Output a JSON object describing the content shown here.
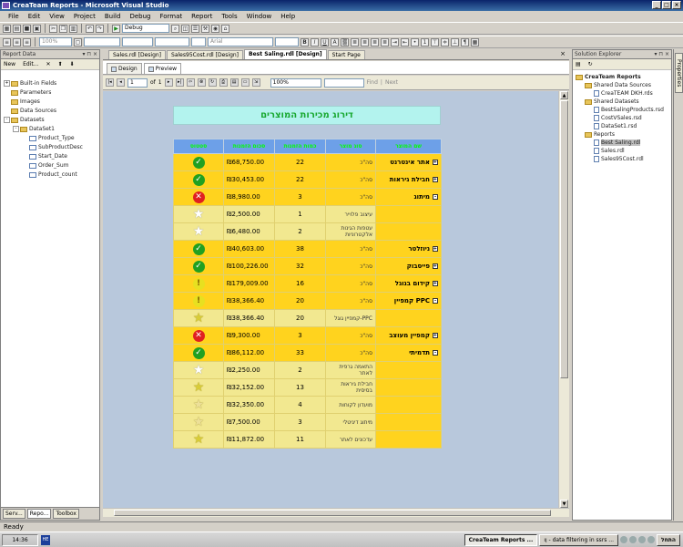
{
  "window": {
    "title": "CreaTeam Reports - Microsoft Visual Studio"
  },
  "menu": [
    "File",
    "Edit",
    "View",
    "Project",
    "Build",
    "Debug",
    "Format",
    "Report",
    "Tools",
    "Window",
    "Help"
  ],
  "toolbar": {
    "config": "Debug",
    "zoom": "100%",
    "font": "Arial"
  },
  "left_pane": {
    "title": "Report Data",
    "new_label": "New",
    "edit_label": "Edit...",
    "tree": [
      {
        "label": "Built-in Fields",
        "level": 0,
        "kind": "folder",
        "exp": "+"
      },
      {
        "label": "Parameters",
        "level": 0,
        "kind": "folder",
        "exp": ""
      },
      {
        "label": "Images",
        "level": 0,
        "kind": "folder",
        "exp": ""
      },
      {
        "label": "Data Sources",
        "level": 0,
        "kind": "folder",
        "exp": ""
      },
      {
        "label": "Datasets",
        "level": 0,
        "kind": "folder",
        "exp": "-"
      },
      {
        "label": "DataSet1",
        "level": 1,
        "kind": "folder",
        "exp": "-"
      },
      {
        "label": "Product_Type",
        "level": 2,
        "kind": "field",
        "exp": ""
      },
      {
        "label": "SubProductDesc",
        "level": 2,
        "kind": "field",
        "exp": ""
      },
      {
        "label": "Start_Date",
        "level": 2,
        "kind": "field",
        "exp": ""
      },
      {
        "label": "Order_Sum",
        "level": 2,
        "kind": "field",
        "exp": ""
      },
      {
        "label": "Product_count",
        "level": 2,
        "kind": "field",
        "exp": ""
      }
    ],
    "bottom_tabs": [
      "Serv...",
      "Repo...",
      "Toolbox"
    ]
  },
  "doc_tabs": [
    "Sales.rdl [Design]",
    "Sales95Cost.rdl [Design]",
    "Best Saling.rdl [Design]",
    "Start Page"
  ],
  "design_tabs": {
    "design": "Design",
    "preview": "Preview"
  },
  "report_toolbar": {
    "page": "1",
    "of_label": "of",
    "total": "1",
    "zoom": "100%",
    "find": "Find",
    "next": "Next"
  },
  "report": {
    "title": "דירוג מכירות המוצרים",
    "headers": [
      "שם המוצר",
      "סוג מוצר",
      "כמות הזמנות",
      "סכום הזמנות",
      "סטטוס"
    ],
    "rows": [
      {
        "product": "אתר אינטרנט",
        "toggle": "+",
        "ptype": "סה\"כ",
        "count": "22",
        "sum": "₪68,750.00",
        "status": "ok",
        "sub": false
      },
      {
        "product": "חבילת גיראות",
        "toggle": "+",
        "ptype": "סה\"כ",
        "count": "22",
        "sum": "₪30,453.00",
        "status": "ok",
        "sub": false
      },
      {
        "product": "מיתוג",
        "toggle": "-",
        "ptype": "סה\"כ",
        "count": "3",
        "sum": "₪8,980.00",
        "status": "bad",
        "sub": false
      },
      {
        "product": "",
        "toggle": "",
        "ptype": "עיצוב פלוייר",
        "count": "1",
        "sum": "₪2,500.00",
        "status": "star-empty",
        "sub": true
      },
      {
        "product": "",
        "toggle": "",
        "ptype": "עטפות הגינות אלקטרוניות",
        "count": "2",
        "sum": "₪6,480.00",
        "status": "star-empty",
        "sub": true
      },
      {
        "product": "ניוזלטר",
        "toggle": "+",
        "ptype": "סה\"כ",
        "count": "38",
        "sum": "₪40,603.00",
        "status": "ok",
        "sub": false
      },
      {
        "product": "פייסבוק",
        "toggle": "+",
        "ptype": "סה\"כ",
        "count": "32",
        "sum": "₪100,226.00",
        "status": "ok",
        "sub": false
      },
      {
        "product": "קידום בגוגל",
        "toggle": "+",
        "ptype": "סה\"כ",
        "count": "16",
        "sum": "₪179,009.00",
        "status": "warn",
        "sub": false
      },
      {
        "product": "PPC קמפיין",
        "toggle": "-",
        "ptype": "סה\"כ",
        "count": "20",
        "sum": "₪38,366.40",
        "status": "warn",
        "sub": false
      },
      {
        "product": "",
        "toggle": "",
        "ptype": "PPC-קמפיין גוגל",
        "count": "20",
        "sum": "₪38,366.40",
        "status": "star-full",
        "sub": true
      },
      {
        "product": "קמפיין מעוצב",
        "toggle": "+",
        "ptype": "סה\"כ",
        "count": "3",
        "sum": "₪9,300.00",
        "status": "bad",
        "sub": false
      },
      {
        "product": "תדמיתי",
        "toggle": "-",
        "ptype": "סה\"כ",
        "count": "33",
        "sum": "₪86,112.00",
        "status": "ok",
        "sub": false
      },
      {
        "product": "",
        "toggle": "",
        "ptype": "התאמה גרפית לאתר",
        "count": "2",
        "sum": "₪2,250.00",
        "status": "star-empty",
        "sub": true
      },
      {
        "product": "",
        "toggle": "",
        "ptype": "חבילת גיראות בסיסית",
        "count": "13",
        "sum": "₪32,152.00",
        "status": "star-full",
        "sub": true
      },
      {
        "product": "",
        "toggle": "",
        "ptype": "מועדון לקוחות",
        "count": "4",
        "sum": "₪32,350.00",
        "status": "star-half",
        "sub": true
      },
      {
        "product": "",
        "toggle": "",
        "ptype": "מיתוג דיגיטלי",
        "count": "3",
        "sum": "₪7,500.00",
        "status": "star-half",
        "sub": true
      },
      {
        "product": "",
        "toggle": "",
        "ptype": "עדכונים לאתר",
        "count": "11",
        "sum": "₪11,872.00",
        "status": "star-full",
        "sub": true
      }
    ]
  },
  "solution_explorer": {
    "title": "Solution Explorer",
    "tree": [
      {
        "label": "CreaTeam Reports",
        "level": 0,
        "kind": "project",
        "bold": true
      },
      {
        "label": "Shared Data Sources",
        "level": 1,
        "kind": "folder"
      },
      {
        "label": "CreaTEAM DKH.rds",
        "level": 2,
        "kind": "doc"
      },
      {
        "label": "Shared Datasets",
        "level": 1,
        "kind": "folder"
      },
      {
        "label": "BestSalingProducts.rsd",
        "level": 2,
        "kind": "doc"
      },
      {
        "label": "CostVSales.rsd",
        "level": 2,
        "kind": "doc"
      },
      {
        "label": "DataSet1.rsd",
        "level": 2,
        "kind": "doc"
      },
      {
        "label": "Reports",
        "level": 1,
        "kind": "folder"
      },
      {
        "label": "Best Saling.rdl",
        "level": 2,
        "kind": "doc",
        "selected": true
      },
      {
        "label": "Sales.rdl",
        "level": 2,
        "kind": "doc"
      },
      {
        "label": "Sales95Cost.rdl",
        "level": 2,
        "kind": "doc"
      }
    ]
  },
  "properties_tab": "Properties",
  "status": {
    "text": "Ready"
  },
  "taskbar": {
    "clock": "14:36",
    "lang": "HE",
    "items": [
      "CreaTeam Reports ...",
      "ןו - data filtering in ssrs ..."
    ],
    "start": "התחל"
  }
}
